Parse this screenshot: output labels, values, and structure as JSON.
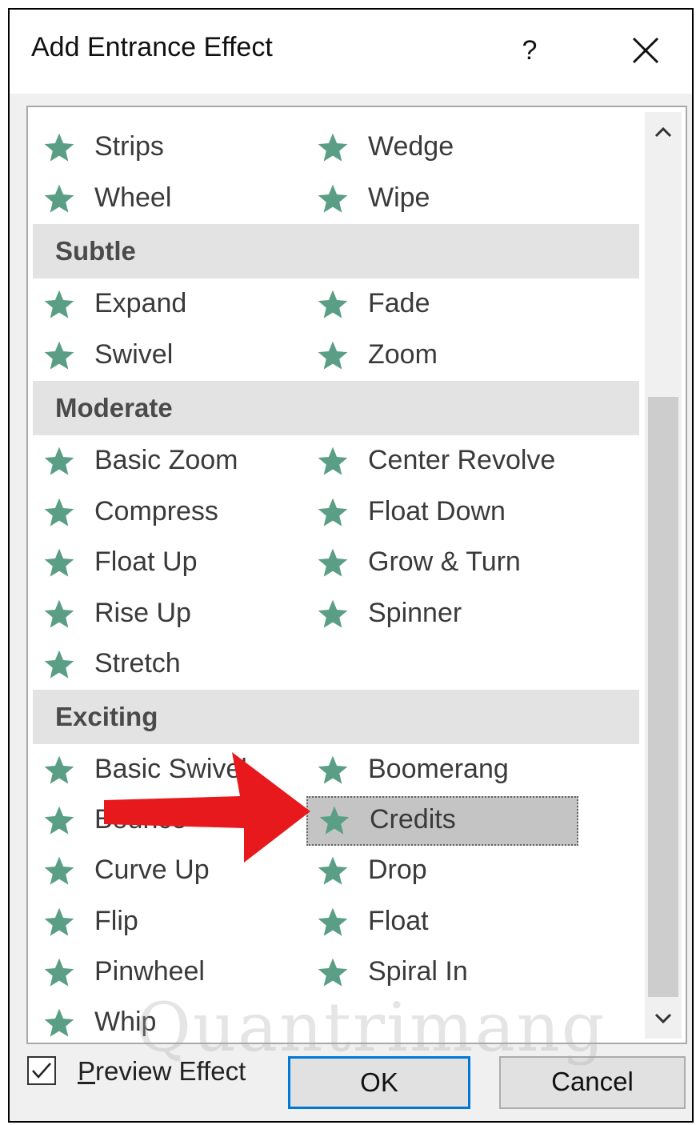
{
  "dialog": {
    "title": "Add Entrance Effect",
    "help_label": "?",
    "close_icon": "close-icon"
  },
  "effects": {
    "top": [
      {
        "label": "Strips"
      },
      {
        "label": "Wedge"
      },
      {
        "label": "Wheel"
      },
      {
        "label": "Wipe"
      }
    ],
    "subtle": {
      "header": "Subtle",
      "items": [
        {
          "label": "Expand"
        },
        {
          "label": "Fade"
        },
        {
          "label": "Swivel"
        },
        {
          "label": "Zoom"
        }
      ]
    },
    "moderate": {
      "header": "Moderate",
      "items": [
        {
          "label": "Basic Zoom"
        },
        {
          "label": "Center Revolve"
        },
        {
          "label": "Compress"
        },
        {
          "label": "Float Down"
        },
        {
          "label": "Float Up"
        },
        {
          "label": "Grow & Turn"
        },
        {
          "label": "Rise Up"
        },
        {
          "label": "Spinner"
        },
        {
          "label": "Stretch"
        }
      ]
    },
    "exciting": {
      "header": "Exciting",
      "items": [
        {
          "label": "Basic Swivel"
        },
        {
          "label": "Boomerang"
        },
        {
          "label": "Bounce"
        },
        {
          "label": "Credits"
        },
        {
          "label": "Curve Up"
        },
        {
          "label": "Drop"
        },
        {
          "label": "Flip"
        },
        {
          "label": "Float"
        },
        {
          "label": "Pinwheel"
        },
        {
          "label": "Spiral In"
        },
        {
          "label": "Whip"
        }
      ]
    },
    "selected": "Credits",
    "star_color": "#5a9e85"
  },
  "footer": {
    "preview_checked": true,
    "preview_label_underlined": "P",
    "preview_label_rest": "review Effect",
    "ok_label": "OK",
    "cancel_label": "Cancel"
  },
  "overlay": {
    "arrow_color": "#e8191c",
    "watermark": "Quantrimang"
  }
}
